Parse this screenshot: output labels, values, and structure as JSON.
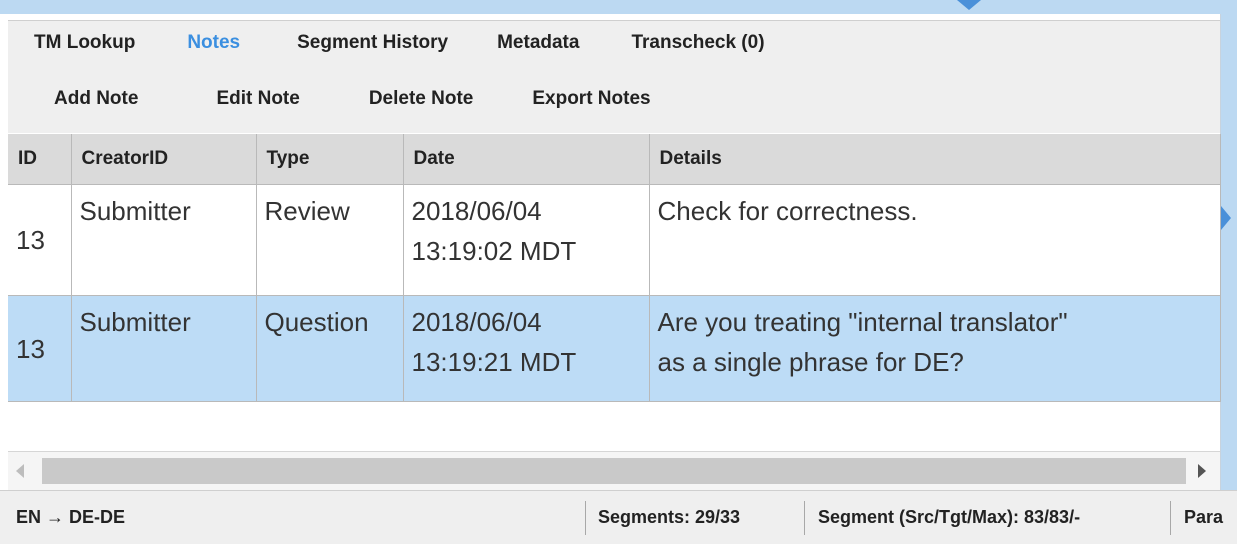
{
  "tabs": [
    {
      "label": "TM Lookup",
      "active": false
    },
    {
      "label": "Notes",
      "active": true
    },
    {
      "label": "Segment History",
      "active": false
    },
    {
      "label": "Metadata",
      "active": false
    },
    {
      "label": "Transcheck (0)",
      "active": false
    }
  ],
  "toolbar": {
    "add_note": "Add Note",
    "edit_note": "Edit Note",
    "delete_note": "Delete Note",
    "export_notes": "Export Notes"
  },
  "table": {
    "columns": [
      "ID",
      "CreatorID",
      "Type",
      "Date",
      "Details"
    ],
    "rows": [
      {
        "id": "13",
        "creator": "Submitter",
        "type": "Review",
        "date_line1": "2018/06/04",
        "date_line2": "13:19:02 MDT",
        "details_line1": "Check for correctness.",
        "details_line2": "",
        "selected": false
      },
      {
        "id": "13",
        "creator": "Submitter",
        "type": "Question",
        "date_line1": "2018/06/04",
        "date_line2": "13:19:21 MDT",
        "details_line1": "Are you treating \"internal translator\"",
        "details_line2": "as a single phrase for DE?",
        "selected": true
      }
    ]
  },
  "status": {
    "language_pair": "EN → DE-DE",
    "segments": "Segments: 29/33",
    "segment_counts": "Segment (Src/Tgt/Max): 83/83/-",
    "para_truncated": "Para"
  },
  "colors": {
    "accent": "#3b8fe0",
    "selected_row": "#bddcf6",
    "panel_bg": "#efefef",
    "header_bg": "#dadada",
    "frame_blue": "#bcd9f2"
  }
}
